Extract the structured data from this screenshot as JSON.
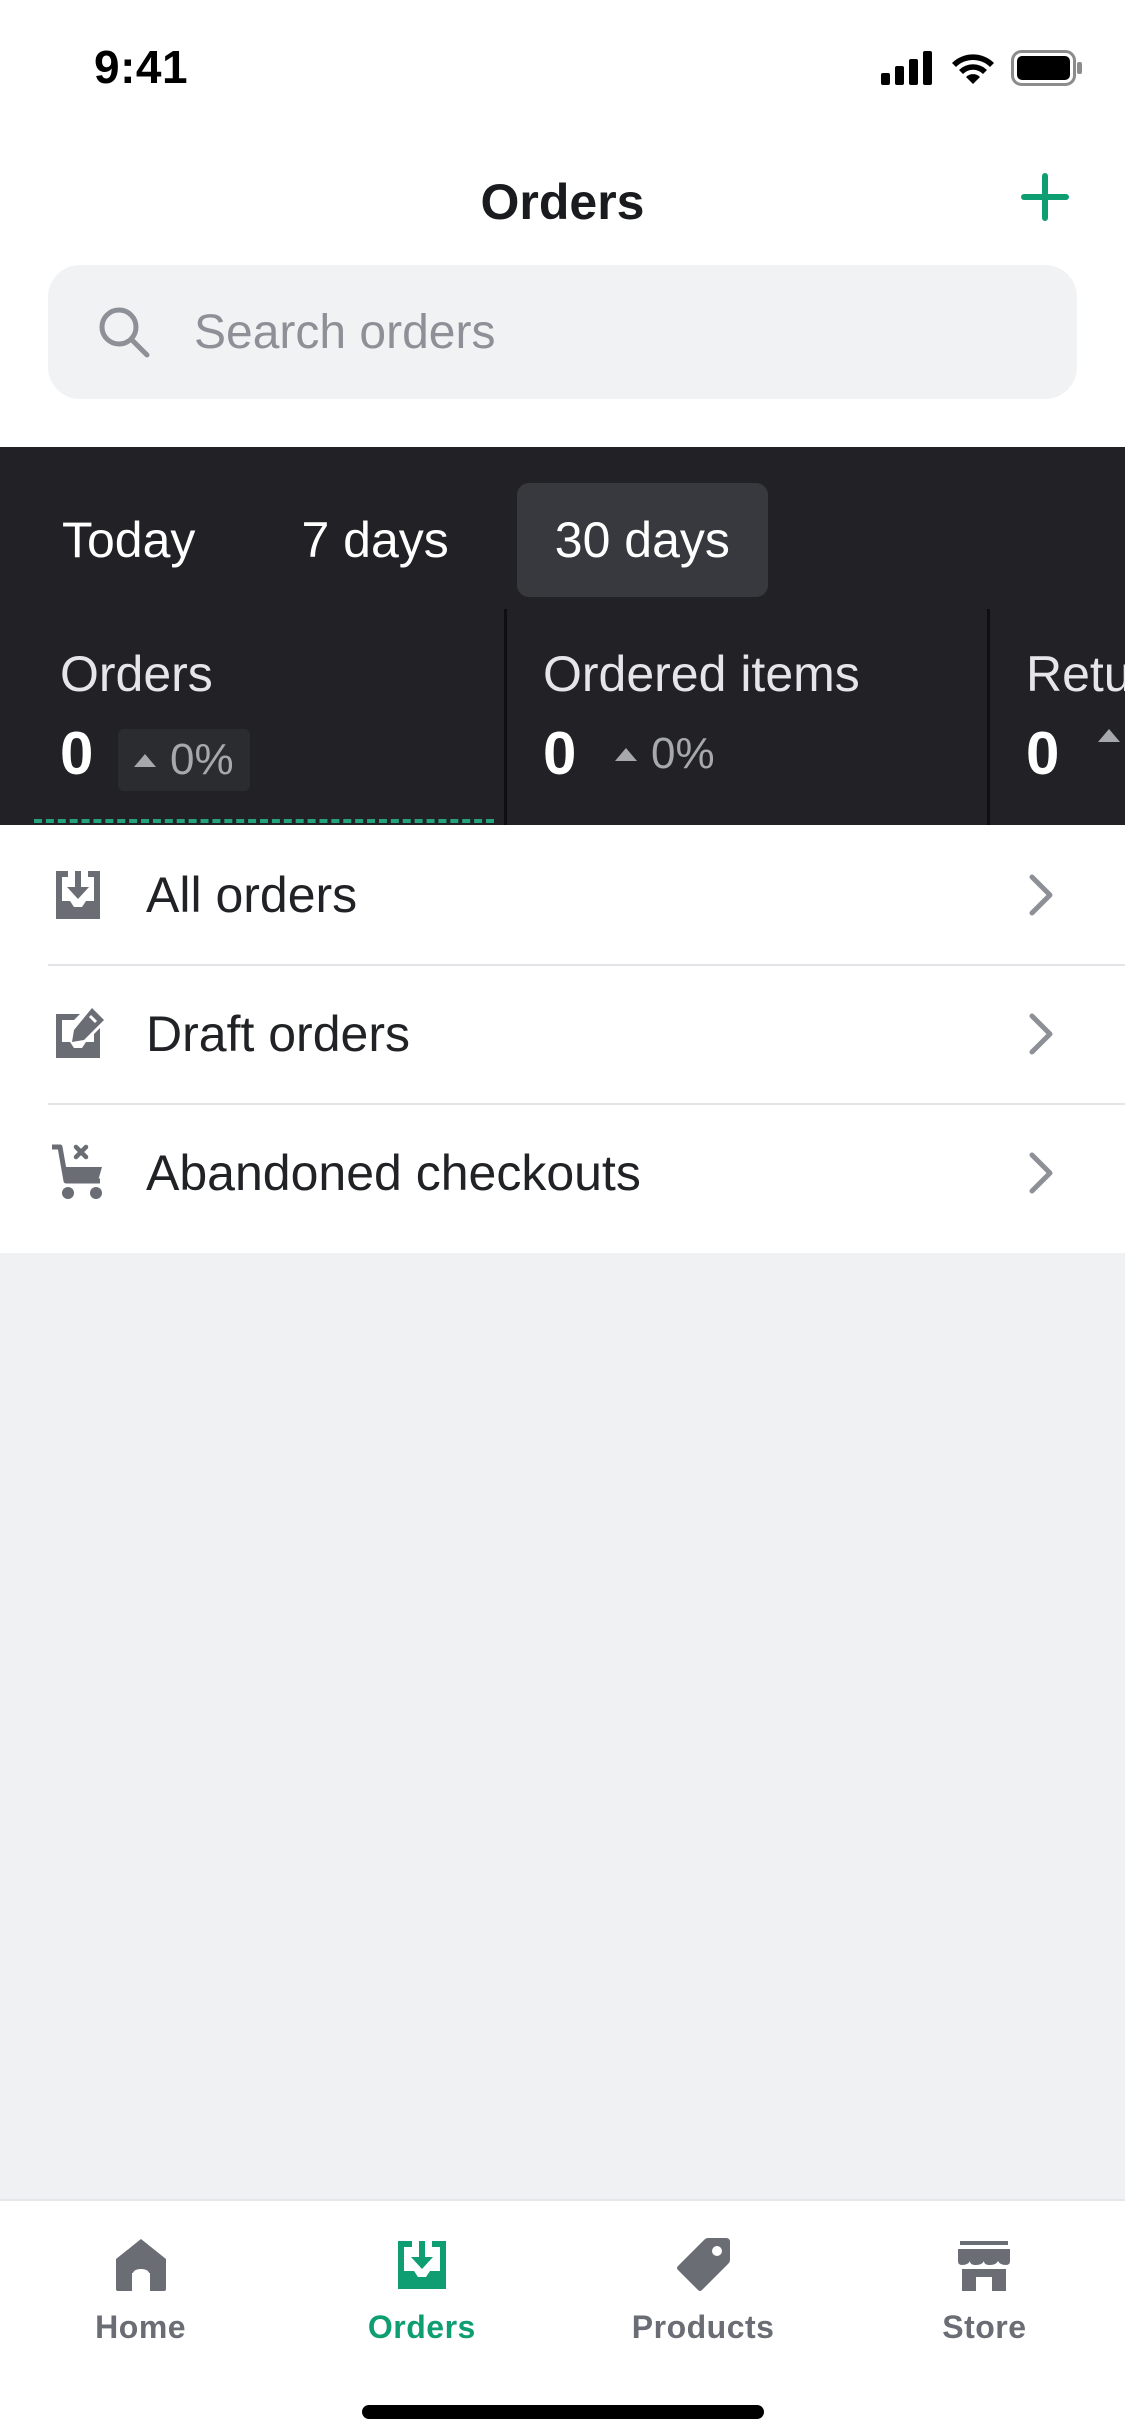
{
  "status_bar": {
    "time": "9:41"
  },
  "header": {
    "title": "Orders",
    "search_placeholder": "Search orders"
  },
  "range_tabs": [
    {
      "label": "Today",
      "active": false
    },
    {
      "label": "7 days",
      "active": false
    },
    {
      "label": "30 days",
      "active": true
    }
  ],
  "metrics": [
    {
      "label": "Orders",
      "value": "0",
      "change": "0%"
    },
    {
      "label": "Ordered items",
      "value": "0",
      "change": "0%"
    },
    {
      "label": "Retu",
      "value": "0",
      "change": ""
    }
  ],
  "list": [
    {
      "label": "All orders",
      "icon": "inbox-download-icon"
    },
    {
      "label": "Draft orders",
      "icon": "draft-edit-icon"
    },
    {
      "label": "Abandoned checkouts",
      "icon": "cart-cancel-icon"
    }
  ],
  "tabs": [
    {
      "label": "Home",
      "icon": "home-icon",
      "active": false
    },
    {
      "label": "Orders",
      "icon": "orders-icon",
      "active": true
    },
    {
      "label": "Products",
      "icon": "tag-icon",
      "active": false
    },
    {
      "label": "Store",
      "icon": "store-icon",
      "active": false
    }
  ],
  "colors": {
    "accent": "#0f9d72",
    "analytics_bg": "#222226",
    "sparkline": "#24a27e",
    "icon_gray": "#6a6d74"
  }
}
